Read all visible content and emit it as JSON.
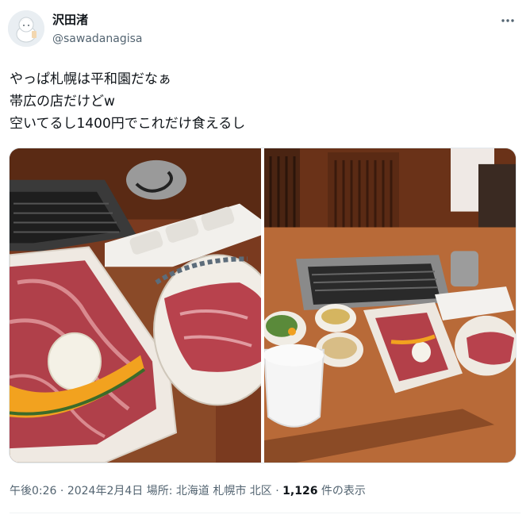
{
  "author": {
    "display_name": "沢田渚",
    "handle": "@sawadanagisa",
    "avatar_icon": "avatar-illustration"
  },
  "tweet": {
    "lines": [
      "やっぱ札幌は平和園だなぁ",
      "帯広の店だけどw",
      "空いてるし1400円でこれだけ食えるし"
    ]
  },
  "media": {
    "photos": [
      {
        "name": "yakiniku-plate-closeup-photo"
      },
      {
        "name": "yakiniku-table-setting-photo"
      }
    ]
  },
  "meta": {
    "time": "午後0:26",
    "separator": " · ",
    "date": "2024年2月4日",
    "location_prefix": "場所: ",
    "location": "北海道 札幌市 北区",
    "views_count": "1,126",
    "views_label": " 件の表示"
  },
  "icons": {
    "more": "more-horizontal-icon"
  },
  "colors": {
    "text_primary": "#0f1419",
    "text_secondary": "#536471",
    "border": "#eff3f4"
  }
}
